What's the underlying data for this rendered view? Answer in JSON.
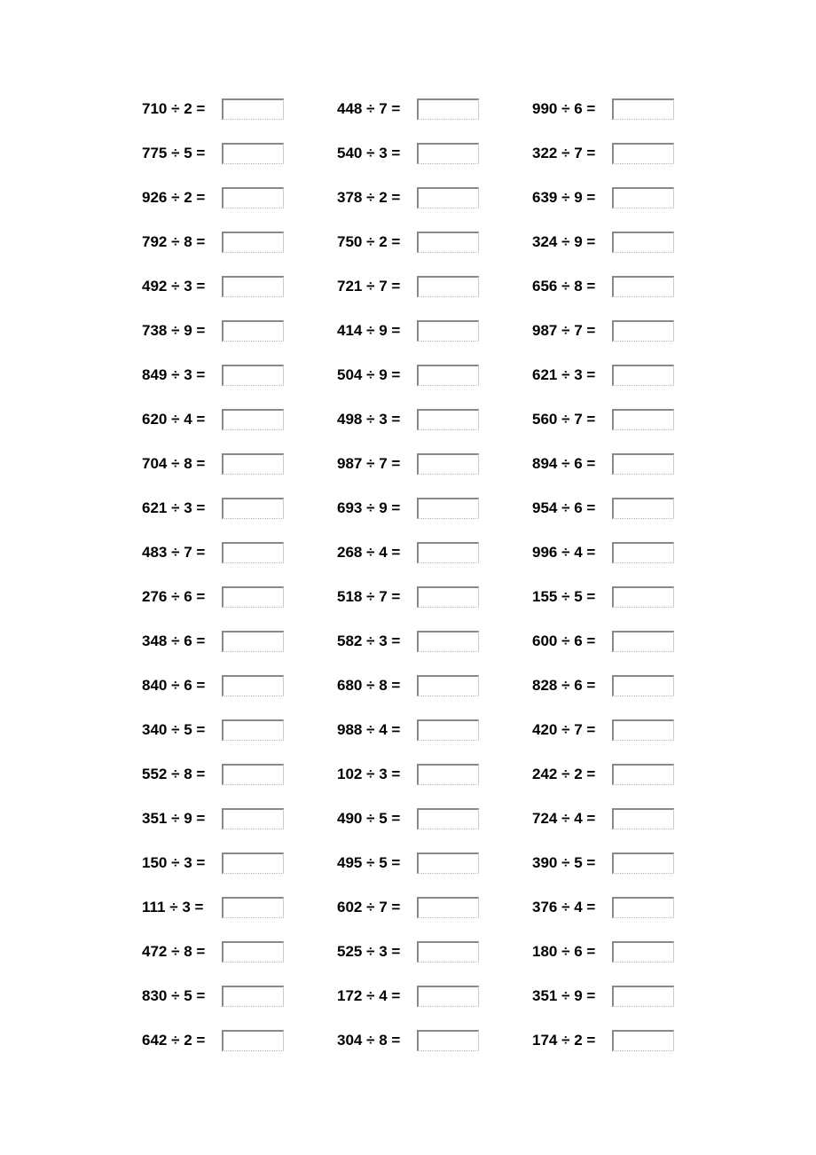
{
  "symbols": {
    "divide": "÷",
    "equals": "="
  },
  "columns": [
    [
      {
        "dividend": 710,
        "divisor": 2
      },
      {
        "dividend": 775,
        "divisor": 5
      },
      {
        "dividend": 926,
        "divisor": 2
      },
      {
        "dividend": 792,
        "divisor": 8
      },
      {
        "dividend": 492,
        "divisor": 3
      },
      {
        "dividend": 738,
        "divisor": 9
      },
      {
        "dividend": 849,
        "divisor": 3
      },
      {
        "dividend": 620,
        "divisor": 4
      },
      {
        "dividend": 704,
        "divisor": 8
      },
      {
        "dividend": 621,
        "divisor": 3
      },
      {
        "dividend": 483,
        "divisor": 7
      },
      {
        "dividend": 276,
        "divisor": 6
      },
      {
        "dividend": 348,
        "divisor": 6
      },
      {
        "dividend": 840,
        "divisor": 6
      },
      {
        "dividend": 340,
        "divisor": 5
      },
      {
        "dividend": 552,
        "divisor": 8
      },
      {
        "dividend": 351,
        "divisor": 9
      },
      {
        "dividend": 150,
        "divisor": 3
      },
      {
        "dividend": 111,
        "divisor": 3
      },
      {
        "dividend": 472,
        "divisor": 8
      },
      {
        "dividend": 830,
        "divisor": 5
      },
      {
        "dividend": 642,
        "divisor": 2
      }
    ],
    [
      {
        "dividend": 448,
        "divisor": 7
      },
      {
        "dividend": 540,
        "divisor": 3
      },
      {
        "dividend": 378,
        "divisor": 2
      },
      {
        "dividend": 750,
        "divisor": 2
      },
      {
        "dividend": 721,
        "divisor": 7
      },
      {
        "dividend": 414,
        "divisor": 9
      },
      {
        "dividend": 504,
        "divisor": 9
      },
      {
        "dividend": 498,
        "divisor": 3
      },
      {
        "dividend": 987,
        "divisor": 7
      },
      {
        "dividend": 693,
        "divisor": 9
      },
      {
        "dividend": 268,
        "divisor": 4
      },
      {
        "dividend": 518,
        "divisor": 7
      },
      {
        "dividend": 582,
        "divisor": 3
      },
      {
        "dividend": 680,
        "divisor": 8
      },
      {
        "dividend": 988,
        "divisor": 4
      },
      {
        "dividend": 102,
        "divisor": 3
      },
      {
        "dividend": 490,
        "divisor": 5
      },
      {
        "dividend": 495,
        "divisor": 5
      },
      {
        "dividend": 602,
        "divisor": 7
      },
      {
        "dividend": 525,
        "divisor": 3
      },
      {
        "dividend": 172,
        "divisor": 4
      },
      {
        "dividend": 304,
        "divisor": 8
      }
    ],
    [
      {
        "dividend": 990,
        "divisor": 6
      },
      {
        "dividend": 322,
        "divisor": 7
      },
      {
        "dividend": 639,
        "divisor": 9
      },
      {
        "dividend": 324,
        "divisor": 9
      },
      {
        "dividend": 656,
        "divisor": 8
      },
      {
        "dividend": 987,
        "divisor": 7
      },
      {
        "dividend": 621,
        "divisor": 3
      },
      {
        "dividend": 560,
        "divisor": 7
      },
      {
        "dividend": 894,
        "divisor": 6
      },
      {
        "dividend": 954,
        "divisor": 6
      },
      {
        "dividend": 996,
        "divisor": 4
      },
      {
        "dividend": 155,
        "divisor": 5
      },
      {
        "dividend": 600,
        "divisor": 6
      },
      {
        "dividend": 828,
        "divisor": 6
      },
      {
        "dividend": 420,
        "divisor": 7
      },
      {
        "dividend": 242,
        "divisor": 2
      },
      {
        "dividend": 724,
        "divisor": 4
      },
      {
        "dividend": 390,
        "divisor": 5
      },
      {
        "dividend": 376,
        "divisor": 4
      },
      {
        "dividend": 180,
        "divisor": 6
      },
      {
        "dividend": 351,
        "divisor": 9
      },
      {
        "dividend": 174,
        "divisor": 2
      }
    ]
  ]
}
